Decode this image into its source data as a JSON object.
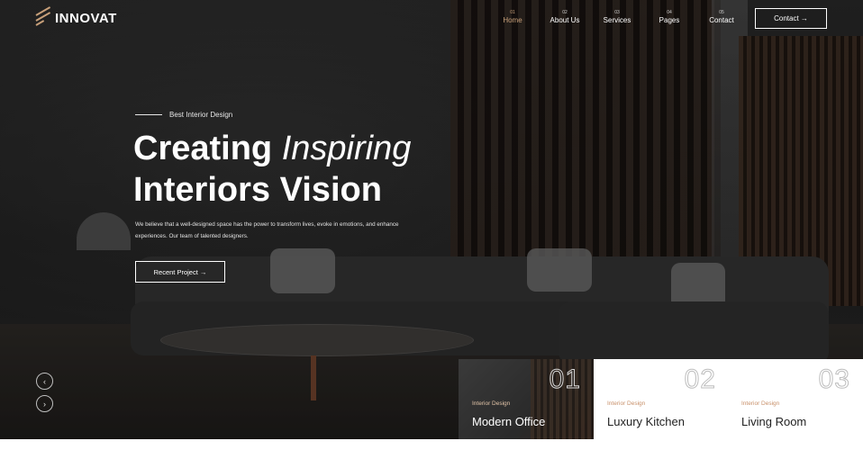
{
  "brand": {
    "name": "INNOVAT",
    "accent": "#c8a07a"
  },
  "nav": {
    "items": [
      {
        "num": "01",
        "label": "Home",
        "active": true
      },
      {
        "num": "02",
        "label": "About Us"
      },
      {
        "num": "03",
        "label": "Services"
      },
      {
        "num": "04",
        "label": "Pages"
      },
      {
        "num": "05",
        "label": "Contact"
      }
    ],
    "contact_button": "Contact →"
  },
  "hero": {
    "eyebrow": "Best Interior Design",
    "headline_bold": "Creating",
    "headline_italic": "Inspiring",
    "headline_line2": "Interiors Vision",
    "description": "We believe that a well-designed space has the power to transform lives, evoke in emotions, and enhance experiences. Our team of talented designers.",
    "button": "Recent Project →",
    "prev_icon": "‹",
    "next_icon": "›"
  },
  "cards": [
    {
      "num": "01",
      "subtitle": "Interior Design",
      "title": "Modern Office"
    },
    {
      "num": "02",
      "subtitle": "Interior Design",
      "title": "Luxury Kitchen"
    },
    {
      "num": "03",
      "subtitle": "Interior Design",
      "title": "Living Room"
    }
  ]
}
